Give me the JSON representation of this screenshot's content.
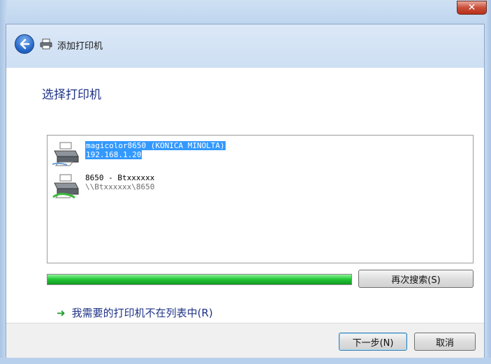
{
  "window": {
    "close_symbol": "✕",
    "title": "添加打印机"
  },
  "page": {
    "heading": "选择打印机"
  },
  "printers": [
    {
      "name": "magicolor8650 (KONICA MINOLTA)",
      "address": "192.168.1.20",
      "selected": true,
      "icon": "network-printer-icon"
    },
    {
      "name": "8650 - Btxxxxxx",
      "address": "\\\\Btxxxxxx\\8650",
      "selected": false,
      "icon": "shared-printer-icon"
    }
  ],
  "search": {
    "progress_percent": 100,
    "search_again_label": "再次搜索(S)"
  },
  "not_listed_link": "我需要的打印机不在列表中(R)",
  "footer": {
    "next_label": "下一步(N)",
    "cancel_label": "取消"
  },
  "colors": {
    "heading": "#1e3287",
    "selection": "#3399ff",
    "progress": "#21c434",
    "close_button": "#c94f3a"
  }
}
